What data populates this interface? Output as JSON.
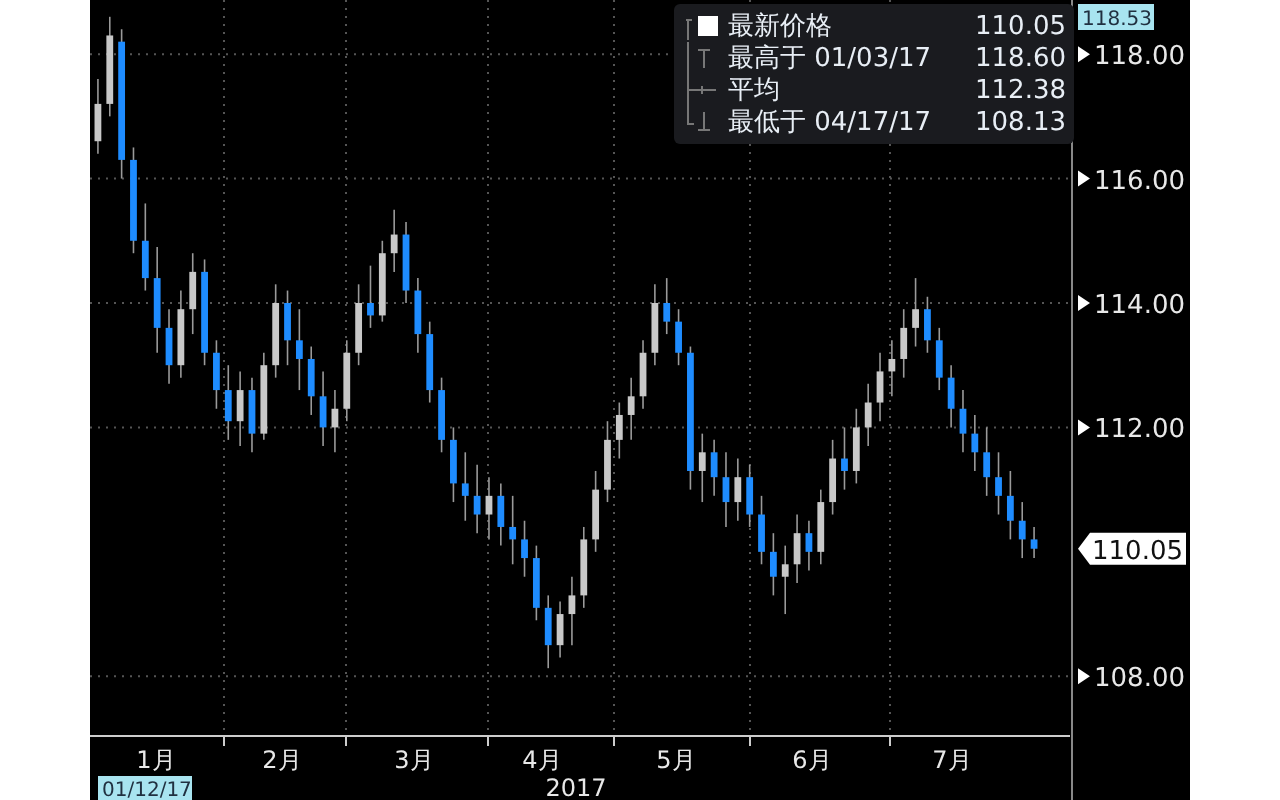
{
  "legend": {
    "items": [
      {
        "kind": "last",
        "label": "最新价格",
        "value": "110.05"
      },
      {
        "kind": "high",
        "label": "最高于 01/03/17",
        "value": "118.60"
      },
      {
        "kind": "average",
        "label": "平均",
        "value": "112.38"
      },
      {
        "kind": "low",
        "label": "最低于 04/17/17",
        "value": "108.13"
      }
    ]
  },
  "y_axis": {
    "top_label": "118.53",
    "last_price": "110.05"
  },
  "x_axis": {
    "months": [
      "1月",
      "2月",
      "3月",
      "4月",
      "5月",
      "6月",
      "7月"
    ],
    "year": "2017",
    "start_date": "01/12/17"
  },
  "chart_data": {
    "type": "candlestick",
    "grid": true,
    "ylim": [
      107.04,
      118.87
    ],
    "yticks": [
      {
        "value": 118,
        "label": "118.00"
      },
      {
        "value": 116,
        "label": "116.00"
      },
      {
        "value": 114,
        "label": "114.00"
      },
      {
        "value": 112,
        "label": "112.00"
      },
      {
        "value": 108,
        "label": "108.00"
      }
    ],
    "categories": [
      null,
      null,
      null,
      null,
      null,
      null,
      null,
      null,
      null,
      null,
      null,
      null,
      null,
      null,
      null,
      null,
      null,
      null,
      null,
      null,
      null,
      null,
      null,
      null,
      null,
      null,
      null,
      null,
      null,
      null,
      null,
      null,
      null,
      null,
      null,
      null,
      null,
      null,
      null,
      null,
      null,
      null,
      null,
      null,
      null,
      null,
      null,
      null,
      null,
      null,
      null,
      null,
      null,
      null,
      null,
      null,
      null,
      null,
      null,
      null,
      null,
      null,
      null,
      null,
      null,
      null,
      null,
      null,
      null,
      null,
      null,
      null,
      null,
      null,
      null,
      null,
      null,
      null,
      null,
      null
    ],
    "ohlc": [
      [
        116.6,
        117.6,
        116.4,
        117.2
      ],
      [
        117.2,
        118.6,
        117.0,
        118.3
      ],
      [
        118.2,
        118.4,
        116.0,
        116.3
      ],
      [
        116.3,
        116.5,
        114.8,
        115.0
      ],
      [
        115.0,
        115.6,
        114.2,
        114.4
      ],
      [
        114.4,
        114.9,
        113.2,
        113.6
      ],
      [
        113.6,
        113.9,
        112.7,
        113.0
      ],
      [
        113.0,
        114.2,
        112.8,
        113.9
      ],
      [
        113.9,
        114.8,
        113.5,
        114.5
      ],
      [
        114.5,
        114.7,
        113.0,
        113.2
      ],
      [
        113.2,
        113.4,
        112.3,
        112.6
      ],
      [
        112.6,
        113.0,
        111.8,
        112.1
      ],
      [
        112.1,
        112.9,
        111.7,
        112.6
      ],
      [
        112.6,
        112.8,
        111.6,
        111.9
      ],
      [
        111.9,
        113.2,
        111.8,
        113.0
      ],
      [
        113.0,
        114.3,
        112.8,
        114.0
      ],
      [
        114.0,
        114.2,
        113.0,
        113.4
      ],
      [
        113.4,
        113.9,
        112.6,
        113.1
      ],
      [
        113.1,
        113.3,
        112.2,
        112.5
      ],
      [
        112.5,
        112.9,
        111.7,
        112.0
      ],
      [
        112.0,
        112.6,
        111.6,
        112.3
      ],
      [
        112.3,
        113.4,
        112.1,
        113.2
      ],
      [
        113.2,
        114.3,
        113.0,
        114.0
      ],
      [
        114.0,
        114.6,
        113.6,
        113.8
      ],
      [
        113.8,
        115.0,
        113.7,
        114.8
      ],
      [
        114.8,
        115.5,
        114.5,
        115.1
      ],
      [
        115.1,
        115.3,
        114.0,
        114.2
      ],
      [
        114.2,
        114.4,
        113.2,
        113.5
      ],
      [
        113.5,
        113.7,
        112.4,
        112.6
      ],
      [
        112.6,
        112.8,
        111.6,
        111.8
      ],
      [
        111.8,
        112.0,
        110.8,
        111.1
      ],
      [
        111.1,
        111.6,
        110.5,
        110.9
      ],
      [
        110.9,
        111.4,
        110.3,
        110.6
      ],
      [
        110.6,
        111.2,
        110.2,
        110.9
      ],
      [
        110.9,
        111.1,
        110.1,
        110.4
      ],
      [
        110.4,
        110.9,
        109.8,
        110.2
      ],
      [
        110.2,
        110.5,
        109.6,
        109.9
      ],
      [
        109.9,
        110.1,
        108.9,
        109.1
      ],
      [
        109.1,
        109.3,
        108.13,
        108.5
      ],
      [
        108.5,
        109.2,
        108.3,
        109.0
      ],
      [
        109.0,
        109.6,
        108.5,
        109.3
      ],
      [
        109.3,
        110.4,
        109.1,
        110.2
      ],
      [
        110.2,
        111.3,
        110.0,
        111.0
      ],
      [
        111.0,
        112.1,
        110.8,
        111.8
      ],
      [
        111.8,
        112.4,
        111.5,
        112.2
      ],
      [
        112.2,
        112.8,
        111.8,
        112.5
      ],
      [
        112.5,
        113.4,
        112.3,
        113.2
      ],
      [
        113.2,
        114.3,
        113.0,
        114.0
      ],
      [
        114.0,
        114.4,
        113.5,
        113.7
      ],
      [
        113.7,
        113.9,
        113.0,
        113.2
      ],
      [
        113.2,
        113.3,
        111.0,
        111.3
      ],
      [
        111.3,
        111.9,
        110.8,
        111.6
      ],
      [
        111.6,
        111.8,
        110.9,
        111.2
      ],
      [
        111.2,
        111.6,
        110.4,
        110.8
      ],
      [
        110.8,
        111.5,
        110.5,
        111.2
      ],
      [
        111.2,
        111.4,
        110.4,
        110.6
      ],
      [
        110.6,
        110.9,
        109.8,
        110.0
      ],
      [
        110.0,
        110.3,
        109.3,
        109.6
      ],
      [
        109.6,
        110.1,
        109.0,
        109.8
      ],
      [
        109.8,
        110.6,
        109.5,
        110.3
      ],
      [
        110.3,
        110.5,
        109.7,
        110.0
      ],
      [
        110.0,
        111.0,
        109.8,
        110.8
      ],
      [
        110.8,
        111.8,
        110.6,
        111.5
      ],
      [
        111.5,
        112.0,
        111.0,
        111.3
      ],
      [
        111.3,
        112.3,
        111.1,
        112.0
      ],
      [
        112.0,
        112.7,
        111.7,
        112.4
      ],
      [
        112.4,
        113.2,
        112.1,
        112.9
      ],
      [
        112.9,
        113.4,
        112.5,
        113.1
      ],
      [
        113.1,
        113.9,
        112.8,
        113.6
      ],
      [
        113.6,
        114.4,
        113.3,
        113.9
      ],
      [
        113.9,
        114.1,
        113.2,
        113.4
      ],
      [
        113.4,
        113.6,
        112.6,
        112.8
      ],
      [
        112.8,
        113.0,
        112.0,
        112.3
      ],
      [
        112.3,
        112.6,
        111.6,
        111.9
      ],
      [
        111.9,
        112.2,
        111.3,
        111.6
      ],
      [
        111.6,
        112.0,
        110.9,
        111.2
      ],
      [
        111.2,
        111.6,
        110.6,
        110.9
      ],
      [
        110.9,
        111.3,
        110.2,
        110.5
      ],
      [
        110.5,
        110.8,
        109.9,
        110.2
      ],
      [
        110.2,
        110.4,
        109.9,
        110.05
      ]
    ]
  }
}
